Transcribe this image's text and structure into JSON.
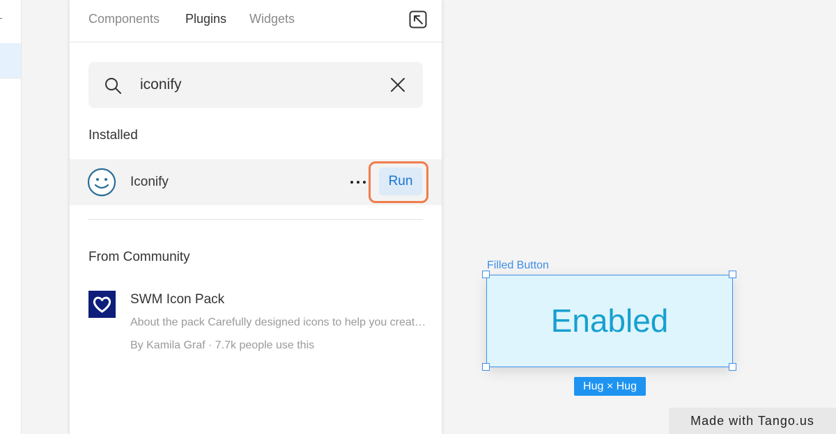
{
  "tabs": [
    {
      "label": "Components"
    },
    {
      "label": "Plugins",
      "active": true
    },
    {
      "label": "Widgets"
    }
  ],
  "search": {
    "value": "iconify",
    "placeholder": "Search"
  },
  "installed": {
    "heading": "Installed",
    "items": [
      {
        "name": "Iconify",
        "run_label": "Run"
      }
    ]
  },
  "community": {
    "heading": "From Community",
    "items": [
      {
        "title": "SWM Icon Pack",
        "description": "About the pack Carefully designed icons to help you create better interfaces",
        "meta": "By Kamila Graf · 7.7k people use this"
      }
    ]
  },
  "canvas": {
    "frame_label": "Filled Button",
    "button_text": "Enabled",
    "size_badge": "Hug × Hug"
  },
  "watermark": "Made with Tango.us",
  "colors": {
    "accent": "#3d8ee8",
    "highlight": "#f07c4a",
    "button_fill": "#def5fd",
    "button_text": "#17a0cf",
    "badge": "#1e94f0"
  }
}
